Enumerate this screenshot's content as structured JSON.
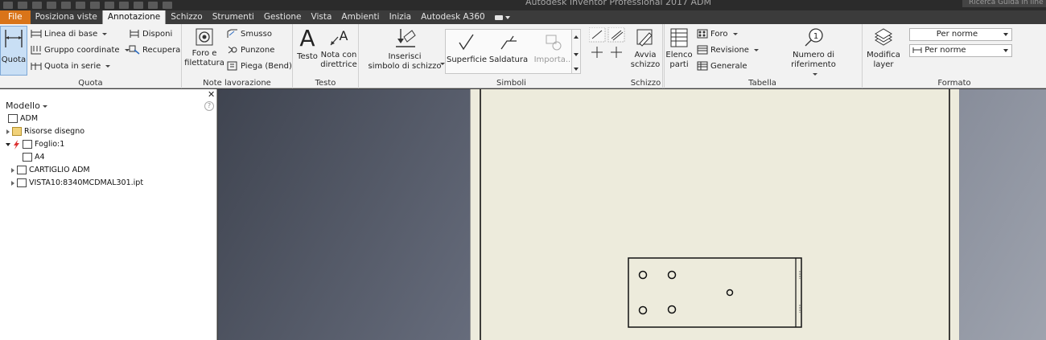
{
  "app": {
    "title": "Autodesk Inventor Professional 2017   ADM",
    "search_placeholder": "Ricerca Guida in line"
  },
  "tabs": [
    {
      "label": "File"
    },
    {
      "label": "Posiziona viste"
    },
    {
      "label": "Annotazione"
    },
    {
      "label": "Schizzo"
    },
    {
      "label": "Strumenti"
    },
    {
      "label": "Gestione"
    },
    {
      "label": "Vista"
    },
    {
      "label": "Ambienti"
    },
    {
      "label": "Inizia"
    },
    {
      "label": "Autodesk A360"
    }
  ],
  "ribbon": {
    "quota": {
      "title": "Quota",
      "big_label": "Quota",
      "items": [
        "Linea di base",
        "Gruppo coordinate",
        "Quota in serie",
        "Disponi",
        "Recupera"
      ]
    },
    "note": {
      "title": "Note lavorazione",
      "big_label1": "Foro e",
      "big_label2": "filettatura",
      "items": [
        "Smusso",
        "Punzone",
        "Piega (Bend)"
      ]
    },
    "testo": {
      "title": "Testo",
      "big1": "Testo",
      "big2_l1": "Nota con",
      "big2_l2": "direttrice"
    },
    "simboli": {
      "title": "Simboli",
      "insert_l1": "Inserisci",
      "insert_l2": "simbolo di schizzo",
      "superficie": "Superficie",
      "saldatura": "Saldatura",
      "importa": "Importa..."
    },
    "schizzo": {
      "title": "Schizzo",
      "big_l1": "Avvia",
      "big_l2": "schizzo"
    },
    "tabella": {
      "title": "Tabella",
      "elenco_l1": "Elenco",
      "elenco_l2": "parti",
      "items": [
        "Foro",
        "Revisione",
        "Generale"
      ],
      "numero": "Numero di riferimento"
    },
    "formato": {
      "title": "Formato",
      "modifica_l1": "Modifica",
      "modifica_l2": "layer",
      "combo1": "Per norme",
      "combo2": "Per norme"
    }
  },
  "browser": {
    "title": "Modello",
    "help": "?",
    "nodes": [
      {
        "label": "ADM"
      },
      {
        "label": "Risorse disegno"
      },
      {
        "label": "Foglio:1"
      },
      {
        "label": "A4"
      },
      {
        "label": "CARTIGLIO ADM"
      },
      {
        "label": "VISTA10:8340MCDMAL301.ipt"
      }
    ]
  },
  "colors": {
    "file_tab": "#d97419",
    "ribbon_bg": "#f2f2f2",
    "sheet_bg": "#edebdc",
    "active_item": "#c9dff5"
  }
}
